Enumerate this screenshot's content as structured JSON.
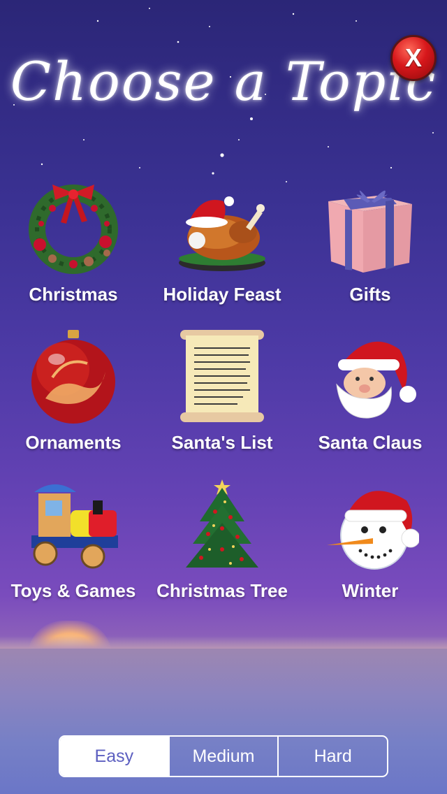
{
  "title": "Choose a Topic",
  "close_button": {
    "label": "X"
  },
  "topics": [
    {
      "label": "Christmas",
      "icon": "wreath-icon"
    },
    {
      "label": "Holiday Feast",
      "icon": "turkey-icon"
    },
    {
      "label": "Gifts",
      "icon": "gift-box-icon"
    },
    {
      "label": "Ornaments",
      "icon": "ornament-icon"
    },
    {
      "label": "Santa's List",
      "icon": "scroll-icon"
    },
    {
      "label": "Santa Claus",
      "icon": "santa-icon"
    },
    {
      "label": "Toys & Games",
      "icon": "toy-train-icon"
    },
    {
      "label": "Christmas Tree",
      "icon": "christmas-tree-icon"
    },
    {
      "label": "Winter",
      "icon": "snowman-icon"
    }
  ],
  "difficulty": {
    "options": [
      "Easy",
      "Medium",
      "Hard"
    ],
    "selected": "Easy"
  },
  "colors": {
    "accent_red": "#d7171b",
    "segment_text": "#5c5fc0"
  }
}
